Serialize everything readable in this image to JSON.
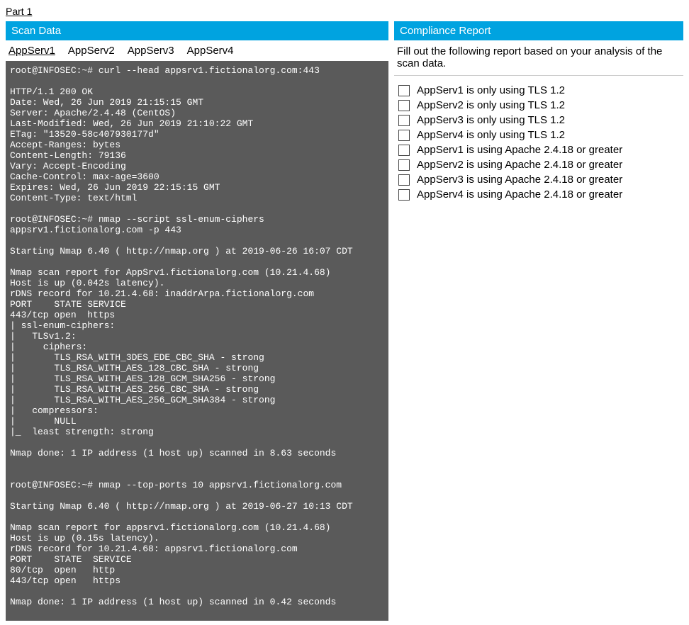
{
  "part_label": "Part 1",
  "left": {
    "header": "Scan Data",
    "tabs": [
      {
        "label": "AppServ1",
        "active": true
      },
      {
        "label": "AppServ2",
        "active": false
      },
      {
        "label": "AppServ3",
        "active": false
      },
      {
        "label": "AppServ4",
        "active": false
      }
    ],
    "terminal": "root@INFOSEC:~# curl --head appsrv1.fictionalorg.com:443\n\nHTTP/1.1 200 OK\nDate: Wed, 26 Jun 2019 21:15:15 GMT\nServer: Apache/2.4.48 (CentOS)\nLast-Modified: Wed, 26 Jun 2019 21:10:22 GMT\nETag: \"13520-58c407930177d\"\nAccept-Ranges: bytes\nContent-Length: 79136\nVary: Accept-Encoding\nCache-Control: max-age=3600\nExpires: Wed, 26 Jun 2019 22:15:15 GMT\nContent-Type: text/html\n\nroot@INFOSEC:~# nmap --script ssl-enum-ciphers\nappsrv1.fictionalorg.com -p 443\n\nStarting Nmap 6.40 ( http://nmap.org ) at 2019-06-26 16:07 CDT\n\nNmap scan report for AppSrv1.fictionalorg.com (10.21.4.68)\nHost is up (0.042s latency).\nrDNS record for 10.21.4.68: inaddrArpa.fictionalorg.com\nPORT    STATE SERVICE\n443/tcp open  https\n| ssl-enum-ciphers:\n|   TLSv1.2:\n|     ciphers:\n|       TLS_RSA_WITH_3DES_EDE_CBC_SHA - strong\n|       TLS_RSA_WITH_AES_128_CBC_SHA - strong\n|       TLS_RSA_WITH_AES_128_GCM_SHA256 - strong\n|       TLS_RSA_WITH_AES_256_CBC_SHA - strong\n|       TLS_RSA_WITH_AES_256_GCM_SHA384 - strong\n|   compressors:\n|       NULL\n|_  least strength: strong\n\nNmap done: 1 IP address (1 host up) scanned in 8.63 seconds\n\n\nroot@INFOSEC:~# nmap --top-ports 10 appsrv1.fictionalorg.com\n\nStarting Nmap 6.40 ( http://nmap.org ) at 2019-06-27 10:13 CDT\n\nNmap scan report for appsrv1.fictionalorg.com (10.21.4.68)\nHost is up (0.15s latency).\nrDNS record for 10.21.4.68: appsrv1.fictionalorg.com\nPORT    STATE  SERVICE\n80/tcp  open   http\n443/tcp open   https\n\nNmap done: 1 IP address (1 host up) scanned in 0.42 seconds"
  },
  "right": {
    "header": "Compliance Report",
    "instructions": "Fill out the following report based on your analysis of the scan data.",
    "items": [
      {
        "label": "AppServ1 is only using TLS 1.2"
      },
      {
        "label": "AppServ2 is only using TLS 1.2"
      },
      {
        "label": "AppServ3 is only using TLS 1.2"
      },
      {
        "label": "AppServ4 is only using TLS 1.2"
      },
      {
        "label": "AppServ1 is using Apache 2.4.18 or greater"
      },
      {
        "label": "AppServ2 is using Apache 2.4.18 or greater"
      },
      {
        "label": "AppServ3 is using Apache 2.4.18 or greater"
      },
      {
        "label": "AppServ4 is using Apache 2.4.18 or greater"
      }
    ]
  }
}
